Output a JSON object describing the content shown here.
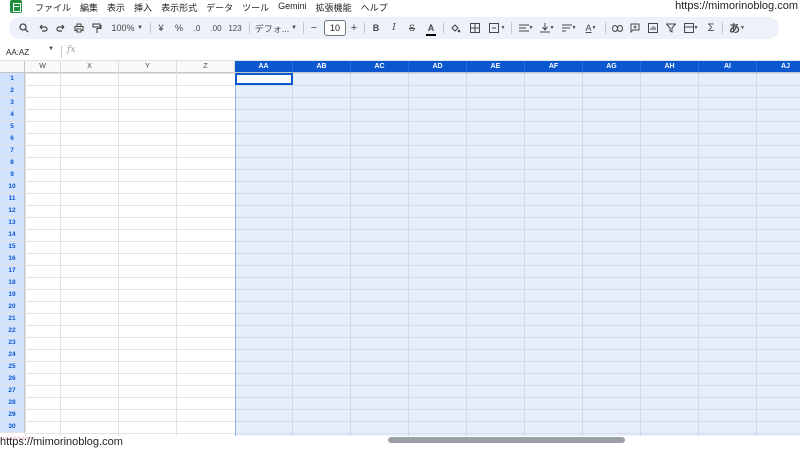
{
  "menu": [
    "ファイル",
    "編集",
    "表示",
    "挿入",
    "表示形式",
    "データ",
    "ツール",
    "Gemini",
    "拡張機能",
    "ヘルプ"
  ],
  "watermark": "https://mimorinoblog.com",
  "toolbar": {
    "zoom": "100%",
    "currency": "¥",
    "percent": "%",
    "dec_decrease": ".0",
    "dec_increase": ".00",
    "format_123": "123",
    "font": "デフォ...",
    "minus": "−",
    "font_size": "10",
    "plus": "+",
    "bold": "B",
    "italic": "I",
    "strike": "S",
    "text_color_glyph": "A",
    "text_color": "#000000",
    "more_glyph": "あ",
    "sum_glyph": "Σ"
  },
  "formula_bar": {
    "name_box": "AA:AZ",
    "fx": "fx",
    "value": ""
  },
  "columns_plain": [
    "W",
    "X",
    "Y",
    "Z"
  ],
  "columns_selected": [
    "AA",
    "AB",
    "AC",
    "AD",
    "AE",
    "AF",
    "AG",
    "AH",
    "AI",
    "AJ"
  ],
  "rows": [
    "1",
    "2",
    "3",
    "4",
    "5",
    "6",
    "7",
    "8",
    "9",
    "10",
    "11",
    "12",
    "13",
    "14",
    "15",
    "16",
    "17",
    "18",
    "19",
    "20",
    "21",
    "22",
    "23",
    "24",
    "25",
    "26",
    "27",
    "28",
    "29",
    "30"
  ],
  "colors": {
    "accent": "#0b57d0",
    "selection_fill": "#e6edfb",
    "toolbar_bg": "#edf2fa",
    "sheets_green": "#1e8e3e"
  }
}
